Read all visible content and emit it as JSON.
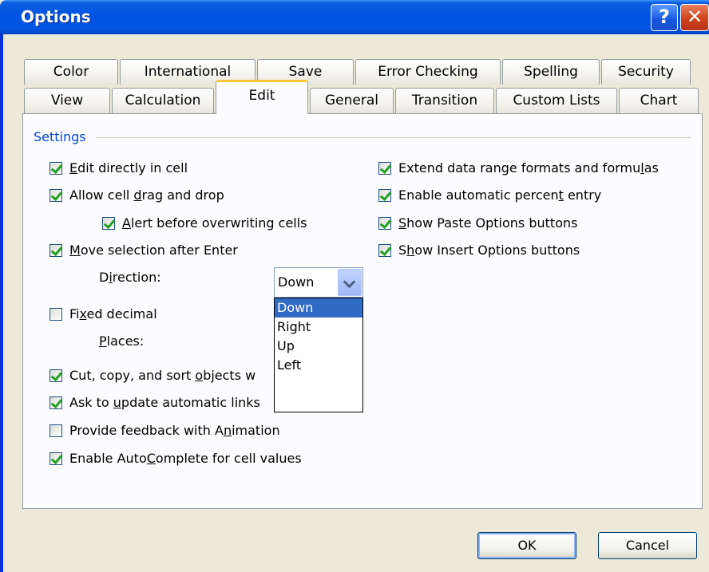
{
  "window": {
    "title": "Options",
    "help_glyph": "?",
    "close_glyph": "✕"
  },
  "tabs_row1": [
    {
      "label": "Color"
    },
    {
      "label": "International"
    },
    {
      "label": "Save"
    },
    {
      "label": "Error Checking"
    },
    {
      "label": "Spelling"
    },
    {
      "label": "Security"
    }
  ],
  "tabs_row2": [
    {
      "label": "View"
    },
    {
      "label": "Calculation"
    },
    {
      "label": "Edit",
      "active": true
    },
    {
      "label": "General"
    },
    {
      "label": "Transition"
    },
    {
      "label": "Custom Lists"
    },
    {
      "label": "Chart"
    }
  ],
  "settings": {
    "title": "Settings",
    "edit_directly": {
      "pre": "",
      "key": "E",
      "post": "dit directly in cell",
      "checked": true
    },
    "drag_drop": {
      "pre": "Allow cell ",
      "key": "d",
      "post": "rag and drop",
      "checked": true
    },
    "alert_overwrite": {
      "pre": "",
      "key": "A",
      "post": "lert before overwriting cells",
      "checked": true
    },
    "move_selection": {
      "pre": "",
      "key": "M",
      "post": "ove selection after Enter",
      "checked": true
    },
    "direction_label": {
      "pre": "D",
      "key": "i",
      "post": "rection:"
    },
    "fixed_decimal": {
      "pre": "Fi",
      "key": "x",
      "post": "ed decimal",
      "checked": false
    },
    "places_label": {
      "pre": "",
      "key": "P",
      "post": "laces:"
    },
    "cut_copy_sort": {
      "pre": "Cut, copy, and sort ",
      "key": "o",
      "post": "bjects w",
      "checked": true
    },
    "ask_update": {
      "pre": "Ask to ",
      "key": "u",
      "post": "pdate automatic links",
      "checked": true
    },
    "feedback_animation": {
      "pre": "Provide feedback with A",
      "key": "n",
      "post": "imation",
      "checked": false
    },
    "autocomplete": {
      "pre": "Enable Auto",
      "key": "C",
      "post": "omplete for cell values",
      "checked": true
    },
    "extend_range": {
      "pre": "Extend data range formats and formu",
      "key": "l",
      "post": "as",
      "checked": true
    },
    "percent_entry": {
      "pre": "Enable automatic percen",
      "key": "t",
      "post": " entry",
      "checked": true
    },
    "paste_options": {
      "pre": "",
      "key": "S",
      "post": "how Paste Options buttons",
      "checked": true
    },
    "insert_options": {
      "pre": "S",
      "key": "h",
      "post": "ow Insert Options buttons",
      "checked": true
    }
  },
  "direction": {
    "selected": "Down",
    "options": [
      "Down",
      "Right",
      "Up",
      "Left"
    ]
  },
  "buttons": {
    "ok": "OK",
    "cancel": "Cancel"
  }
}
